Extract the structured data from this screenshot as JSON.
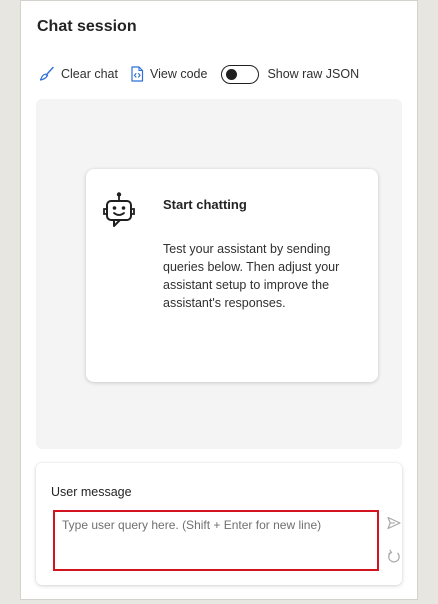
{
  "header": {
    "title": "Chat session"
  },
  "toolbar": {
    "clear_chat": "Clear chat",
    "view_code": "View code",
    "show_raw_json": "Show raw JSON",
    "show_raw_json_on": false
  },
  "empty_state": {
    "title": "Start chatting",
    "body": "Test your assistant by sending queries below. Then adjust your assistant setup to improve the assistant's responses.",
    "icon": "bot-icon"
  },
  "user_message": {
    "label": "User message",
    "placeholder": "Type user query here. (Shift + Enter for new line)",
    "value": ""
  },
  "colors": {
    "accent": "#2f6fd6",
    "highlight_border": "#d1141f",
    "background": "#e8e6e1"
  }
}
